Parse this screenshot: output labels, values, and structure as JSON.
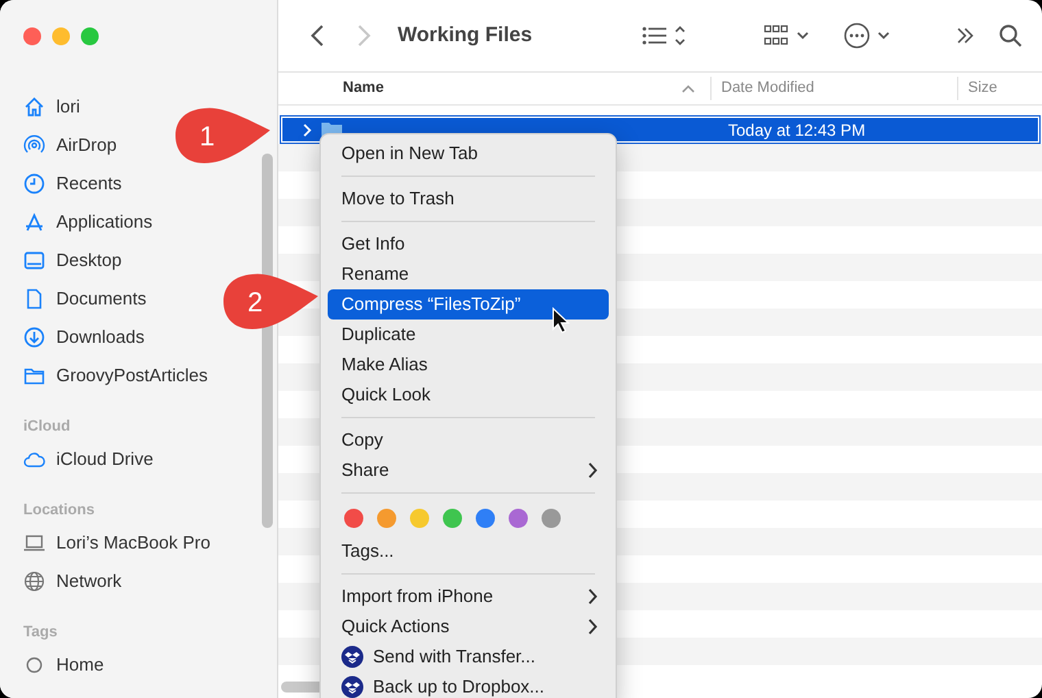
{
  "sidebar": {
    "sections": [
      {
        "items": [
          {
            "label": "lori",
            "kind": "home"
          },
          {
            "label": "AirDrop",
            "kind": "airdrop"
          },
          {
            "label": "Recents",
            "kind": "clock"
          },
          {
            "label": "Applications",
            "kind": "apps"
          },
          {
            "label": "Desktop",
            "kind": "desktop"
          },
          {
            "label": "Documents",
            "kind": "document"
          },
          {
            "label": "Downloads",
            "kind": "download"
          },
          {
            "label": "GroovyPostArticles",
            "kind": "folder"
          }
        ]
      },
      {
        "header": "iCloud",
        "items": [
          {
            "label": "iCloud Drive",
            "kind": "cloud"
          }
        ]
      },
      {
        "header": "Locations",
        "items": [
          {
            "label": "Lori’s MacBook Pro",
            "kind": "laptop"
          },
          {
            "label": "Network",
            "kind": "globe"
          }
        ]
      },
      {
        "header": "Tags",
        "items": [
          {
            "label": "Home",
            "kind": "tag"
          }
        ]
      }
    ]
  },
  "toolbar": {
    "title": "Working Files",
    "back_disabled": false,
    "forward_disabled": true
  },
  "table": {
    "columns": [
      {
        "label": "Name",
        "sorted": true
      },
      {
        "label": "Date Modified",
        "sorted": false
      },
      {
        "label": "Size",
        "sorted": false
      }
    ],
    "rows": [
      {
        "date_modified": "Today at 12:43 PM",
        "selected": true,
        "expanded": false
      }
    ]
  },
  "context_menu": {
    "items": [
      {
        "kind": "item",
        "label": "Open in New Tab",
        "selected": false,
        "submenu": false
      },
      {
        "kind": "separator"
      },
      {
        "kind": "item",
        "label": "Move to Trash",
        "selected": false,
        "submenu": false
      },
      {
        "kind": "separator"
      },
      {
        "kind": "item",
        "label": "Get Info",
        "selected": false,
        "submenu": false
      },
      {
        "kind": "item",
        "label": "Rename",
        "selected": false,
        "submenu": false
      },
      {
        "kind": "item",
        "label": "Compress “FilesToZip”",
        "selected": true,
        "submenu": false
      },
      {
        "kind": "item",
        "label": "Duplicate",
        "selected": false,
        "submenu": false
      },
      {
        "kind": "item",
        "label": "Make Alias",
        "selected": false,
        "submenu": false
      },
      {
        "kind": "item",
        "label": "Quick Look",
        "selected": false,
        "submenu": false
      },
      {
        "kind": "separator"
      },
      {
        "kind": "item",
        "label": "Copy",
        "selected": false,
        "submenu": false
      },
      {
        "kind": "item",
        "label": "Share",
        "selected": false,
        "submenu": true
      },
      {
        "kind": "separator"
      },
      {
        "kind": "tags",
        "colors": [
          {
            "color": "#f14c48"
          },
          {
            "color": "#f59a2f"
          },
          {
            "color": "#f6c92e"
          },
          {
            "color": "#3fc54f"
          },
          {
            "color": "#2f7ff6"
          },
          {
            "color": "#a968d3"
          },
          {
            "color": "#999999"
          }
        ]
      },
      {
        "kind": "item",
        "label": "Tags...",
        "selected": false,
        "submenu": false
      },
      {
        "kind": "separator"
      },
      {
        "kind": "item",
        "label": "Import from iPhone",
        "selected": false,
        "submenu": true
      },
      {
        "kind": "item",
        "label": "Quick Actions",
        "selected": false,
        "submenu": true
      },
      {
        "kind": "app",
        "label": "Send with Transfer...",
        "selected": false,
        "submenu": false
      },
      {
        "kind": "app",
        "label": "Back up to Dropbox...",
        "selected": false,
        "submenu": false
      }
    ]
  },
  "callouts": [
    {
      "number": "1"
    },
    {
      "number": "2"
    }
  ]
}
